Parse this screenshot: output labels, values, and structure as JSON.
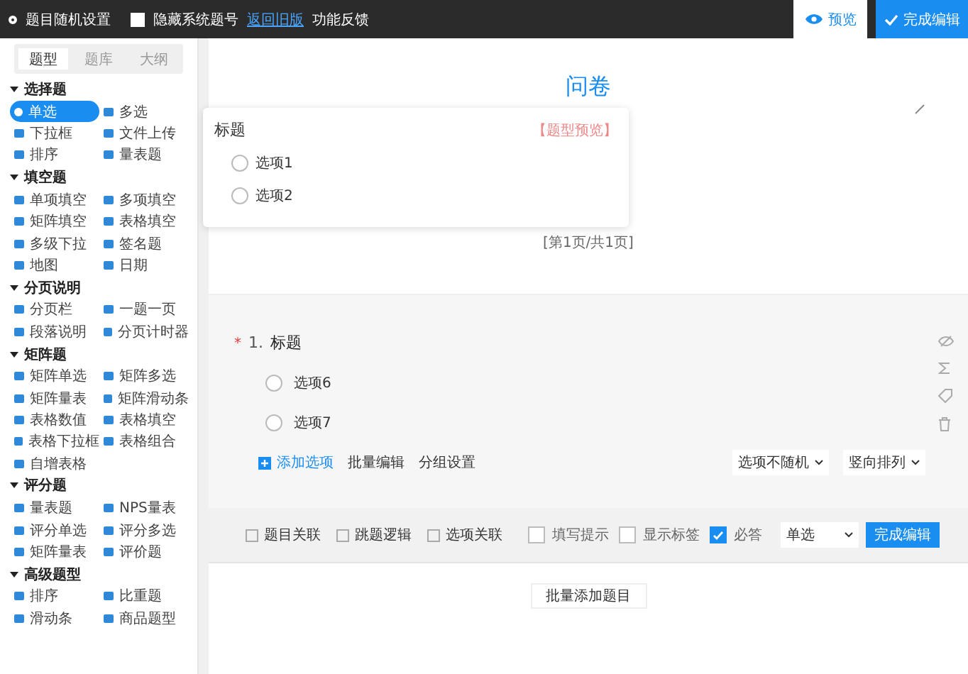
{
  "top_bar": {
    "random_setting": "题目随机设置",
    "hide_number": {
      "label": "隐藏系统题号",
      "checked": false
    },
    "back_link": "返回旧版",
    "feedback": "功能反馈",
    "preview": "预览",
    "finish": "完成编辑"
  },
  "sidebar": {
    "tabs": [
      {
        "label": "题型",
        "selected": true
      },
      {
        "label": "题库",
        "selected": false
      },
      {
        "label": "大纲",
        "selected": false
      }
    ],
    "groups": [
      {
        "title": "选择题",
        "items": [
          {
            "label": "单选",
            "selected": true
          },
          {
            "label": "多选",
            "selected": false
          },
          {
            "label": "下拉框",
            "selected": false
          },
          {
            "label": "文件上传",
            "selected": false
          },
          {
            "label": "排序",
            "selected": false
          },
          {
            "label": "量表题",
            "selected": false
          }
        ]
      },
      {
        "title": "填空题",
        "items": [
          {
            "label": "单项填空",
            "selected": false
          },
          {
            "label": "多项填空",
            "selected": false
          },
          {
            "label": "矩阵填空",
            "selected": false
          },
          {
            "label": "表格填空",
            "selected": false
          },
          {
            "label": "多级下拉",
            "selected": false
          },
          {
            "label": "签名题",
            "selected": false
          },
          {
            "label": "地图",
            "selected": false
          },
          {
            "label": "日期",
            "selected": false
          }
        ]
      },
      {
        "title": "分页说明",
        "items": [
          {
            "label": "分页栏",
            "selected": false
          },
          {
            "label": "一题一页",
            "selected": false
          },
          {
            "label": "段落说明",
            "selected": false
          },
          {
            "label": "分页计时器",
            "selected": false
          }
        ]
      },
      {
        "title": "矩阵题",
        "items": [
          {
            "label": "矩阵单选",
            "selected": false
          },
          {
            "label": "矩阵多选",
            "selected": false
          },
          {
            "label": "矩阵量表",
            "selected": false
          },
          {
            "label": "矩阵滑动条",
            "selected": false
          },
          {
            "label": "表格数值",
            "selected": false
          },
          {
            "label": "表格填空",
            "selected": false
          },
          {
            "label": "表格下拉框",
            "selected": false
          },
          {
            "label": "表格组合",
            "selected": false
          },
          {
            "label": "自增表格",
            "selected": false
          }
        ]
      },
      {
        "title": "评分题",
        "items": [
          {
            "label": "量表题",
            "selected": false
          },
          {
            "label": "NPS量表",
            "selected": false
          },
          {
            "label": "评分单选",
            "selected": false
          },
          {
            "label": "评分多选",
            "selected": false
          },
          {
            "label": "矩阵量表",
            "selected": false
          },
          {
            "label": "评价题",
            "selected": false
          }
        ]
      },
      {
        "title": "高级题型",
        "items": [
          {
            "label": "排序",
            "selected": false
          },
          {
            "label": "比重题",
            "selected": false
          },
          {
            "label": "滑动条",
            "selected": false
          },
          {
            "label": "商品题型",
            "selected": false
          }
        ]
      }
    ]
  },
  "preview_popover": {
    "title": "标题",
    "tag": "【题型预览】",
    "options": [
      {
        "label": "选项1",
        "selected": false
      },
      {
        "label": "选项2",
        "selected": false
      }
    ]
  },
  "survey": {
    "title": "问卷",
    "page_indicator": "[第1页/共1页]"
  },
  "question": {
    "required_mark": "*",
    "number": "1.",
    "title": "标题",
    "options": [
      {
        "label": "选项6",
        "selected": false
      },
      {
        "label": "选项7",
        "selected": false
      }
    ],
    "actions": [
      "添加选项",
      "批量编辑",
      "分组设置"
    ],
    "dropdowns": [
      "选项不随机",
      "竖向排列"
    ],
    "links": [
      "题目关联",
      "跳题逻辑",
      "选项关联"
    ],
    "checks": [
      {
        "label": "填写提示",
        "checked": false
      },
      {
        "label": "显示标签",
        "checked": false
      },
      {
        "label": "必答",
        "checked": true
      }
    ],
    "type_select": "单选",
    "done": "完成编辑"
  },
  "batch_add": "批量添加题目"
}
